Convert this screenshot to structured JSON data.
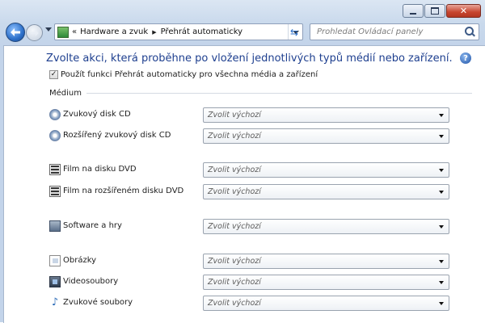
{
  "window": {
    "caption_buttons": {
      "minimize": "minimize",
      "maximize": "maximize",
      "close": "close"
    }
  },
  "nav": {
    "breadcrumb_prefix": "«",
    "crumbs": [
      "Hardware a zvuk",
      "Přehrát automaticky"
    ],
    "search_placeholder": "Prohledat Ovládací panely",
    "icons": {
      "back": "back-arrow-icon",
      "forward": "forward-arrow-icon",
      "refresh": "refresh-icon",
      "search": "search-icon"
    }
  },
  "page": {
    "title": "Zvolte akci, která proběhne po vložení jednotlivých typů médií nebo zařízení.",
    "help_glyph": "?",
    "autoplay_checkbox": {
      "label": "Použít funkci Přehrát automaticky pro všechna média a zařízení",
      "checked": true,
      "check_glyph": "✓"
    },
    "section_label": "Médium",
    "default_choice": "Zvolit výchozí",
    "media": [
      {
        "name": "Zvukový disk CD",
        "icon": "disc-icon"
      },
      {
        "name": "Rozšířený zvukový disk CD",
        "icon": "disc-icon"
      },
      {
        "name": "Film na disku DVD",
        "icon": "film-icon"
      },
      {
        "name": "Film na rozšířeném disku DVD",
        "icon": "film-icon"
      },
      {
        "name": "Software a hry",
        "icon": "software-icon"
      },
      {
        "name": "Obrázky",
        "icon": "picture-icon"
      },
      {
        "name": "Videosoubory",
        "icon": "video-icon"
      },
      {
        "name": "Zvukové soubory",
        "icon": "audio-icon"
      }
    ],
    "audio_glyph": "♪"
  }
}
